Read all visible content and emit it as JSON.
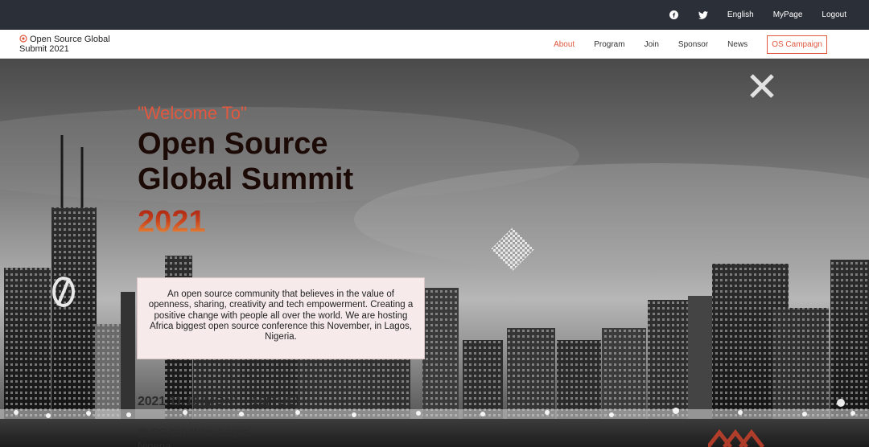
{
  "topbar": {
    "icons": [
      "facebook-icon",
      "twitter-icon"
    ],
    "language": "English",
    "mypage": "MyPage",
    "logout": "Logout"
  },
  "header": {
    "logo_text": "Open Source Global Submit 2021",
    "nav": [
      "About",
      "Program",
      "Join",
      "Sponsor",
      "News"
    ],
    "active_nav": "About",
    "campaign": "OS Campaign"
  },
  "hero": {
    "welcome": "\"Welcome To\"",
    "title_line1": "Open Source",
    "title_line2": "Global Summit",
    "year": "2021",
    "blurb": "An open source community that believes in the value of openness, sharing, creativity and tech empowerment. Creating a positive change with people all over the world. We are hosting Africa biggest open source conference this November, in Lagos, Nigeria.",
    "date": "2021.11.15(MON) ~ 16(TUE)",
    "venue": "@ CC-hub Yaba, Lagos, Nigeria"
  },
  "colors": {
    "accent": "#e2583e",
    "topbar_bg": "#2b2f37",
    "blurb_bg": "#f6eaea"
  }
}
